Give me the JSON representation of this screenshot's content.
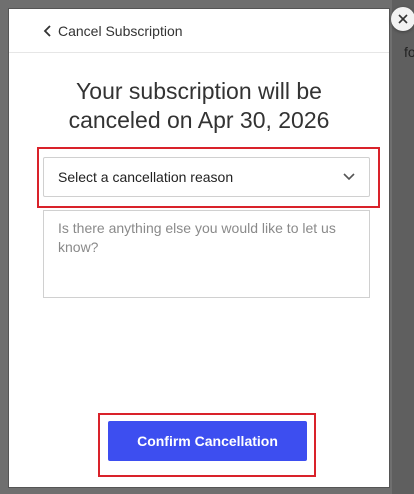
{
  "backdrop": {
    "partial_text": "fo"
  },
  "header": {
    "back_label": "Cancel Subscription"
  },
  "title": {
    "line1": "Your subscription will be",
    "line2": "canceled on Apr 30, 2026"
  },
  "reason_select": {
    "selected": "Select a cancellation reason"
  },
  "comment": {
    "placeholder": "Is there anything else you would like to let us know?"
  },
  "actions": {
    "confirm_label": "Confirm Cancellation"
  },
  "icons": {
    "back": "chevron-left-icon",
    "dropdown": "chevron-down-icon",
    "close": "close-icon"
  },
  "colors": {
    "primary_button": "#3d4ef0",
    "highlight_border": "#d9222a"
  }
}
